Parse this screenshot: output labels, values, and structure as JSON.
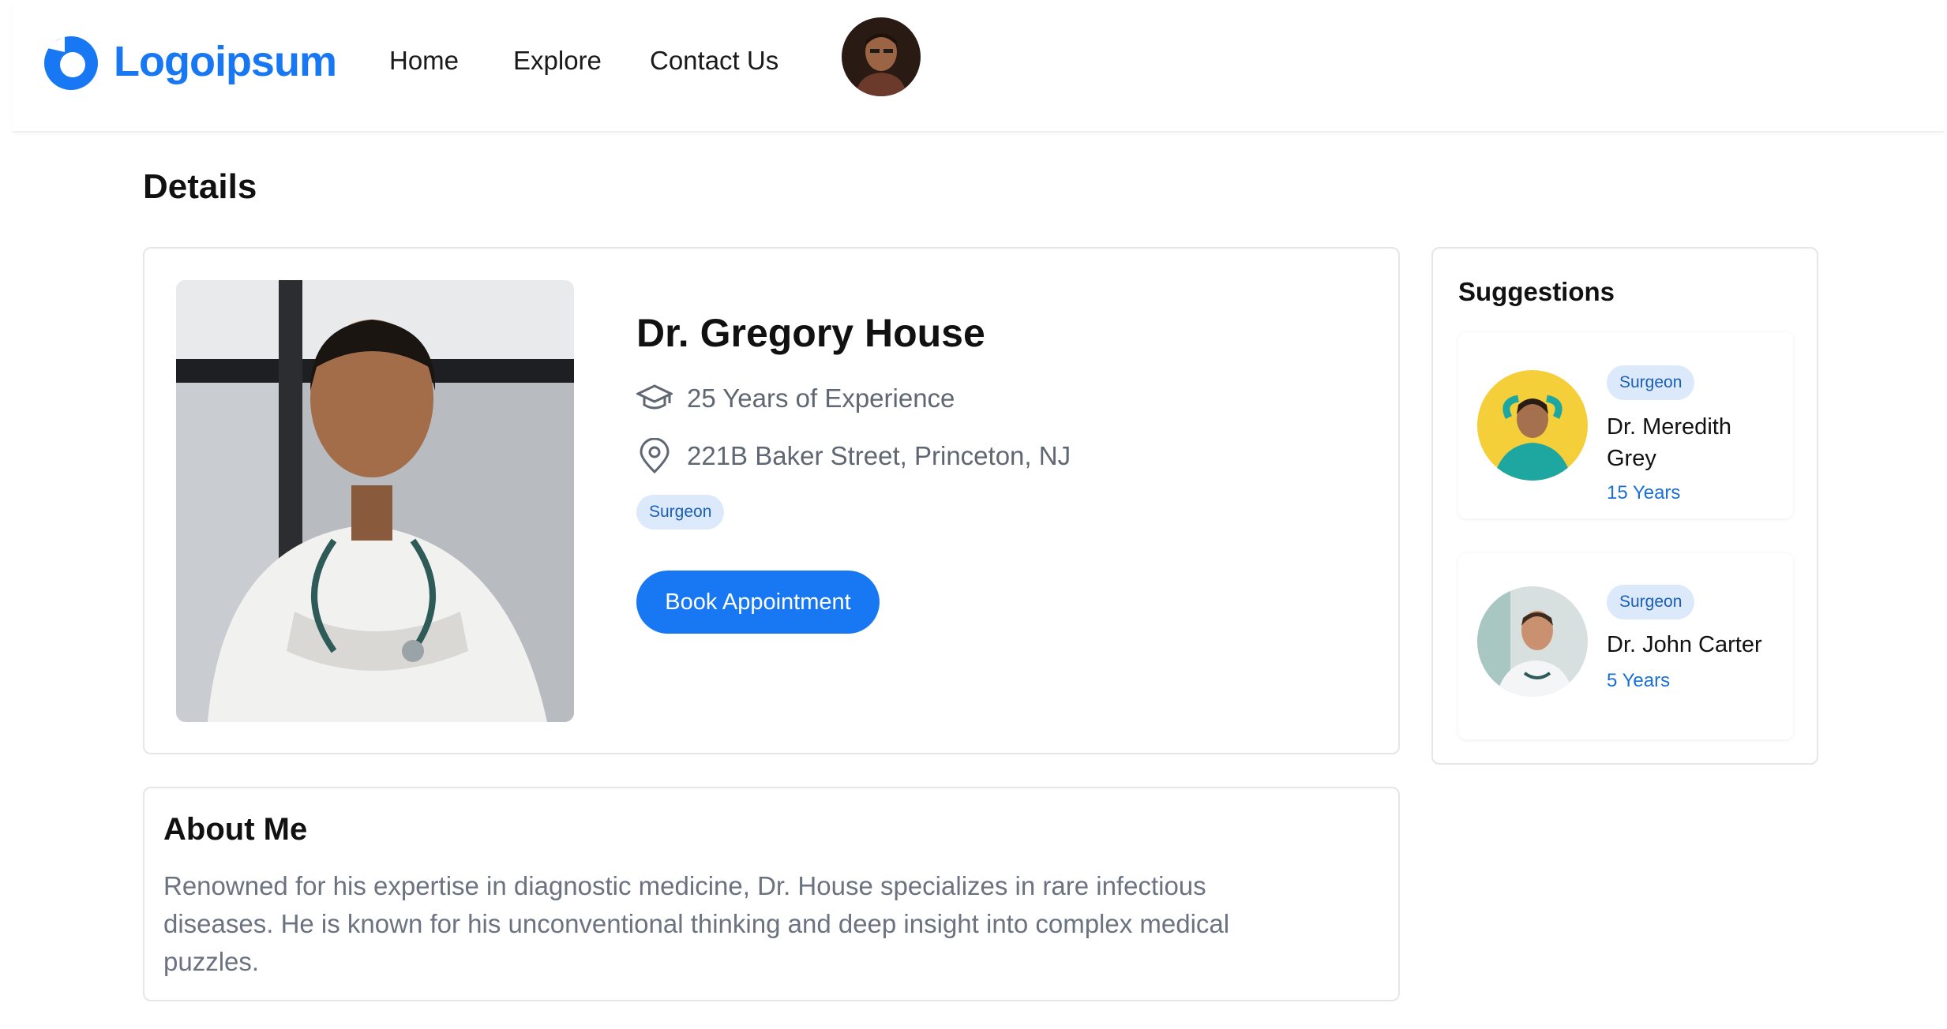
{
  "header": {
    "logo_text": "Logoipsum",
    "nav": [
      "Home",
      "Explore",
      "Contact Us"
    ]
  },
  "page_title": "Details",
  "profile": {
    "name": "Dr. Gregory House",
    "experience": "25 Years of Experience",
    "address": "221B Baker Street, Princeton, NJ",
    "specialty": "Surgeon",
    "book_label": "Book Appointment",
    "icons": [
      "graduation-cap-icon",
      "location-pin-icon"
    ]
  },
  "about": {
    "title": "About Me",
    "text": "Renowned for his expertise in diagnostic medicine, Dr. House specializes in rare infectious diseases. He is known for his unconventional thinking and deep insight into complex medical puzzles."
  },
  "suggestions": {
    "title": "Suggestions",
    "items": [
      {
        "specialty": "Surgeon",
        "name": "Dr. Meredith Grey",
        "years": "15 Years"
      },
      {
        "specialty": "Surgeon",
        "name": "Dr. John Carter",
        "years": "5 Years"
      }
    ]
  },
  "colors": {
    "accent": "#1877f2",
    "badge_bg": "#dbe9fb",
    "muted_text": "#6b7280"
  }
}
